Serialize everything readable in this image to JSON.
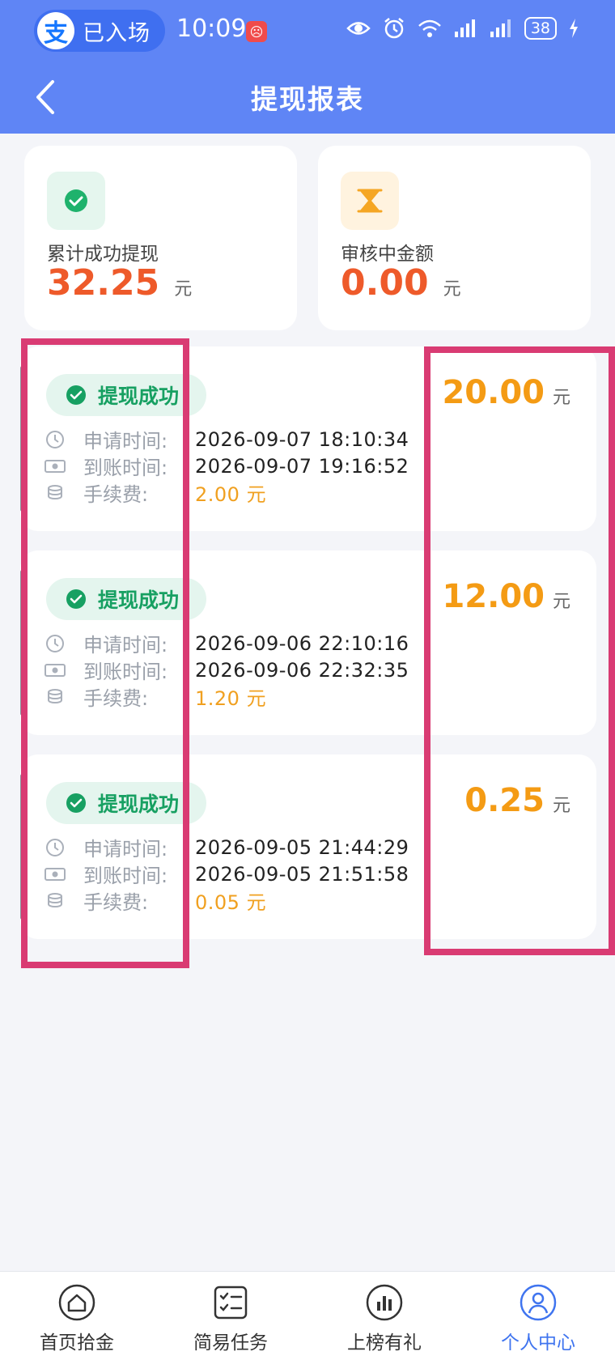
{
  "status_bar": {
    "app_pill_label": "已入场",
    "alipay_glyph": "支",
    "time": "10:09",
    "battery": "38"
  },
  "header": {
    "title": "提现报表"
  },
  "summary": [
    {
      "label": "累计成功提现",
      "amount": "32.25",
      "unit": "元",
      "icon": "check-icon"
    },
    {
      "label": "审核中金额",
      "amount": "0.00",
      "unit": "元",
      "icon": "hourglass-icon"
    }
  ],
  "records": [
    {
      "status": "提现成功",
      "apply_label": "申请时间:",
      "apply_time": "2026-09-07 18:10:34",
      "arrive_label": "到账时间:",
      "arrive_time": "2026-09-07 19:16:52",
      "fee_label": "手续费:",
      "fee": "2.00 元",
      "amount": "20.00",
      "unit": "元"
    },
    {
      "status": "提现成功",
      "apply_label": "申请时间:",
      "apply_time": "2026-09-06 22:10:16",
      "arrive_label": "到账时间:",
      "arrive_time": "2026-09-06 22:32:35",
      "fee_label": "手续费:",
      "fee": "1.20 元",
      "amount": "12.00",
      "unit": "元"
    },
    {
      "status": "提现成功",
      "apply_label": "申请时间:",
      "apply_time": "2026-09-05 21:44:29",
      "arrive_label": "到账时间:",
      "arrive_time": "2026-09-05 21:51:58",
      "fee_label": "手续费:",
      "fee": "0.05 元",
      "amount": "0.25",
      "unit": "元"
    }
  ],
  "tabbar": [
    {
      "label": "首页拾金",
      "icon": "home-icon"
    },
    {
      "label": "简易任务",
      "icon": "checklist-icon"
    },
    {
      "label": "上榜有礼",
      "icon": "bar-chart-icon"
    },
    {
      "label": "个人中心",
      "icon": "user-icon",
      "active": true
    }
  ],
  "colors": {
    "header": "#5f85f5",
    "accent_blue": "#3f74ef",
    "success_green": "#17a062",
    "amount_orange": "#f49b14",
    "total_red": "#ee5a2a",
    "highlight": "#d93b73"
  }
}
